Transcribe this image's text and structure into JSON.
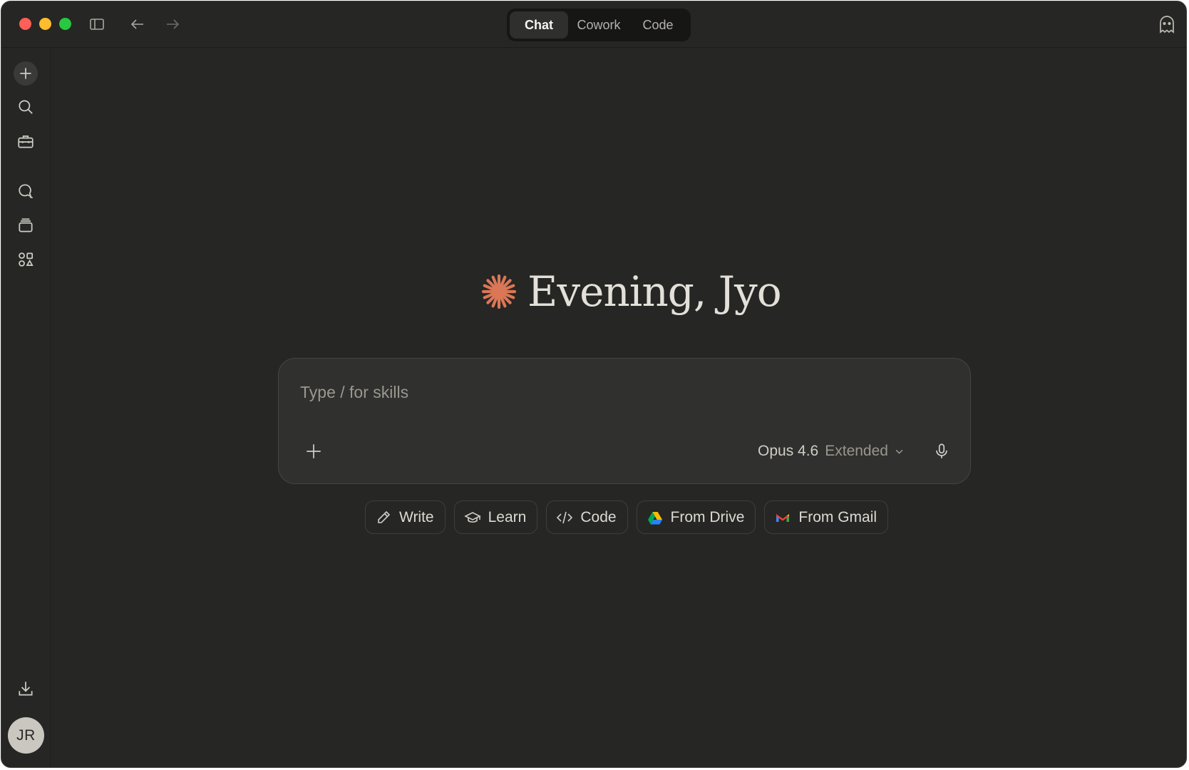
{
  "window": {
    "traffic_lights": [
      "close",
      "minimize",
      "maximize"
    ],
    "toolbar_icons": [
      "sidebar-toggle-icon",
      "back-arrow-icon",
      "forward-arrow-icon"
    ],
    "mode_tabs": [
      {
        "label": "Chat",
        "active": true
      },
      {
        "label": "Cowork",
        "active": false
      },
      {
        "label": "Code",
        "active": false
      }
    ],
    "incognito_icon": "ghost-icon"
  },
  "sidebar": {
    "items": [
      {
        "name": "new-chat",
        "icon": "plus-icon"
      },
      {
        "name": "search",
        "icon": "search-icon"
      },
      {
        "name": "toolbox",
        "icon": "briefcase-icon"
      },
      {
        "name": "chats",
        "icon": "chat-bubbles-icon"
      },
      {
        "name": "projects",
        "icon": "stack-icon"
      },
      {
        "name": "artifacts",
        "icon": "shapes-icon"
      }
    ],
    "download_icon": "download-icon",
    "avatar_initials": "JR"
  },
  "main": {
    "greeting": "Evening, Jyo",
    "greeting_icon": "claude-spark-icon",
    "composer": {
      "placeholder": "Type / for skills",
      "value": "",
      "model": "Opus 4.6",
      "model_mode": "Extended"
    },
    "quick_actions": [
      {
        "label": "Write",
        "icon": "pencil-icon"
      },
      {
        "label": "Learn",
        "icon": "graduation-cap-icon"
      },
      {
        "label": "Code",
        "icon": "code-brackets-icon"
      },
      {
        "label": "From Drive",
        "icon": "google-drive-icon"
      },
      {
        "label": "From Gmail",
        "icon": "gmail-icon"
      }
    ]
  },
  "colors": {
    "background": "#262624",
    "composer_bg": "#30302e",
    "accent_spark": "#d97757",
    "text": "#e8e6df",
    "muted_text": "#9a988f"
  }
}
